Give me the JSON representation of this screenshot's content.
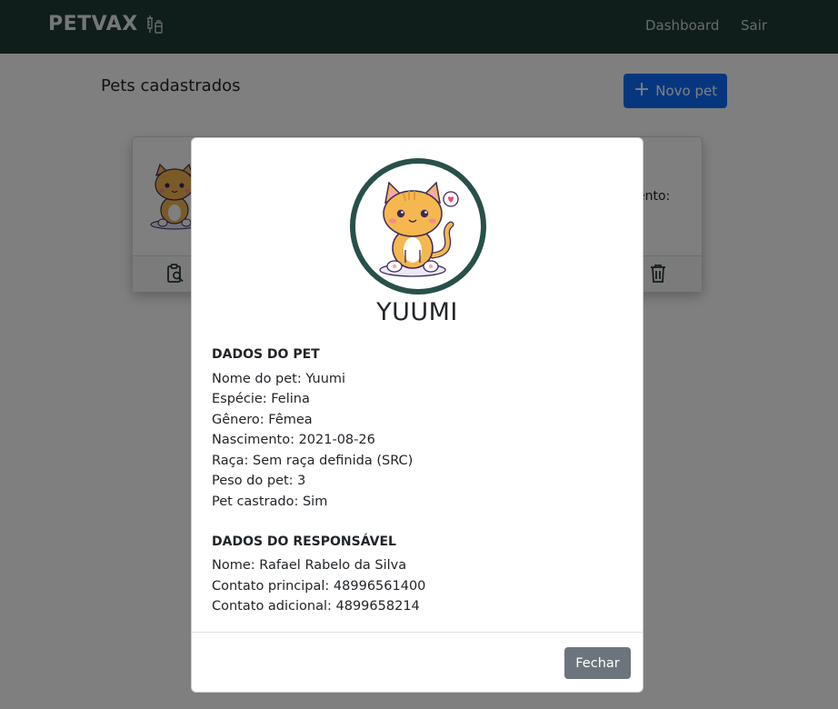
{
  "navbar": {
    "brand": "PETVAX",
    "brand_icon": "syringe-vial-icon",
    "links": [
      "Dashboard",
      "Sair"
    ],
    "bg_color": "#1e3a36"
  },
  "page": {
    "title": "Pets cadastrados",
    "new_pet_button": "Novo pet",
    "new_pet_icon": "plus-icon",
    "accent_color": "#0d6efd"
  },
  "card": {
    "partial_text": "ento:",
    "icons": [
      "clipboard-search-icon",
      "trash-icon"
    ]
  },
  "modal": {
    "pet_name": "YUUMI",
    "avatar_icon": "cat-illustration",
    "ring_color": "#28504a",
    "pet_section": {
      "title": "DADOS DO PET",
      "lines": [
        "Nome do pet: Yuumi",
        "Espécie: Felina",
        "Gênero: Fêmea",
        "Nascimento: 2021-08-26",
        "Raça: Sem raça definida (SRC)",
        "Peso do pet: 3",
        "Pet castrado: Sim"
      ]
    },
    "owner_section": {
      "title": "DADOS DO RESPONSÁVEL",
      "lines": [
        "Nome: Rafael Rabelo da Silva",
        "Contato principal: 48996561400",
        "Contato adicional: 4899658214"
      ]
    },
    "close_button": "Fechar"
  }
}
